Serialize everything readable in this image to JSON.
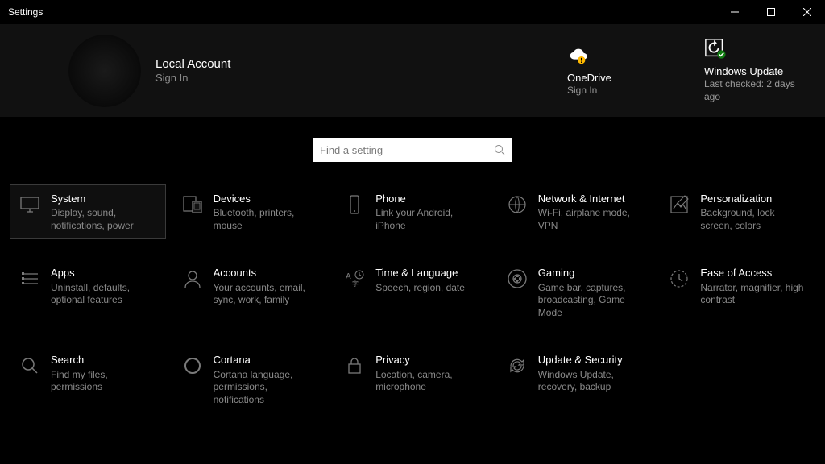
{
  "window": {
    "title": "Settings"
  },
  "account": {
    "name": "Local Account",
    "signin": "Sign In"
  },
  "tiles": {
    "onedrive": {
      "label": "OneDrive",
      "sub": "Sign In"
    },
    "update": {
      "label": "Windows Update",
      "sub": "Last checked: 2 days ago"
    }
  },
  "search": {
    "placeholder": "Find a setting"
  },
  "categories": [
    {
      "id": "system",
      "title": "System",
      "desc": "Display, sound, notifications, power",
      "selected": true
    },
    {
      "id": "devices",
      "title": "Devices",
      "desc": "Bluetooth, printers, mouse",
      "selected": false
    },
    {
      "id": "phone",
      "title": "Phone",
      "desc": "Link your Android, iPhone",
      "selected": false
    },
    {
      "id": "network",
      "title": "Network & Internet",
      "desc": "Wi-Fi, airplane mode, VPN",
      "selected": false
    },
    {
      "id": "personalization",
      "title": "Personalization",
      "desc": "Background, lock screen, colors",
      "selected": false
    },
    {
      "id": "apps",
      "title": "Apps",
      "desc": "Uninstall, defaults, optional features",
      "selected": false
    },
    {
      "id": "accounts",
      "title": "Accounts",
      "desc": "Your accounts, email, sync, work, family",
      "selected": false
    },
    {
      "id": "time",
      "title": "Time & Language",
      "desc": "Speech, region, date",
      "selected": false
    },
    {
      "id": "gaming",
      "title": "Gaming",
      "desc": "Game bar, captures, broadcasting, Game Mode",
      "selected": false
    },
    {
      "id": "ease",
      "title": "Ease of Access",
      "desc": "Narrator, magnifier, high contrast",
      "selected": false
    },
    {
      "id": "search",
      "title": "Search",
      "desc": "Find my files, permissions",
      "selected": false
    },
    {
      "id": "cortana",
      "title": "Cortana",
      "desc": "Cortana language, permissions, notifications",
      "selected": false
    },
    {
      "id": "privacy",
      "title": "Privacy",
      "desc": "Location, camera, microphone",
      "selected": false
    },
    {
      "id": "update",
      "title": "Update & Security",
      "desc": "Windows Update, recovery, backup",
      "selected": false
    }
  ]
}
